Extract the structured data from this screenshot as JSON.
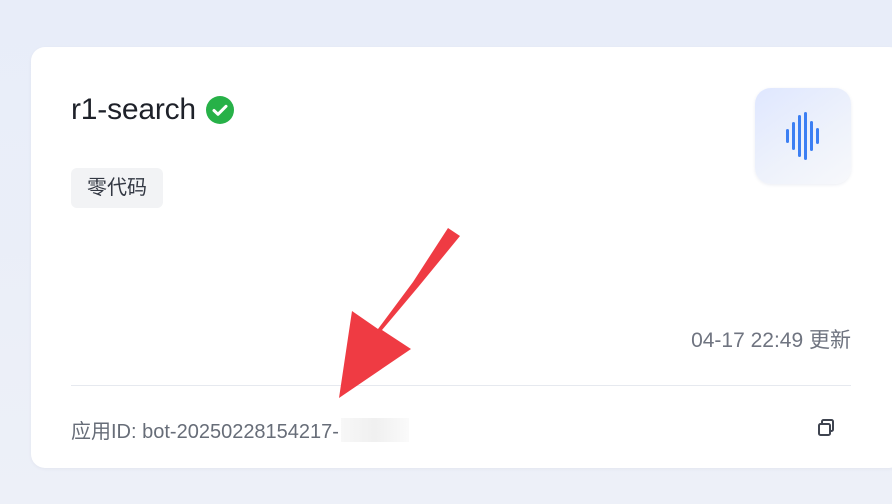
{
  "card": {
    "title": "r1-search",
    "tag": "零代码",
    "updated_text": "04-17 22:49 更新",
    "id_text": "应用ID: bot-20250228154217-"
  },
  "colors": {
    "verified": "#27b148",
    "annotation_arrow": "#ef3b43",
    "avatar_accent": "#3c7ff3"
  },
  "icons": {
    "verified": "check-circle-icon",
    "avatar": "sound-wave-icon",
    "copy": "copy-icon",
    "annotation": "red-arrow-icon"
  }
}
